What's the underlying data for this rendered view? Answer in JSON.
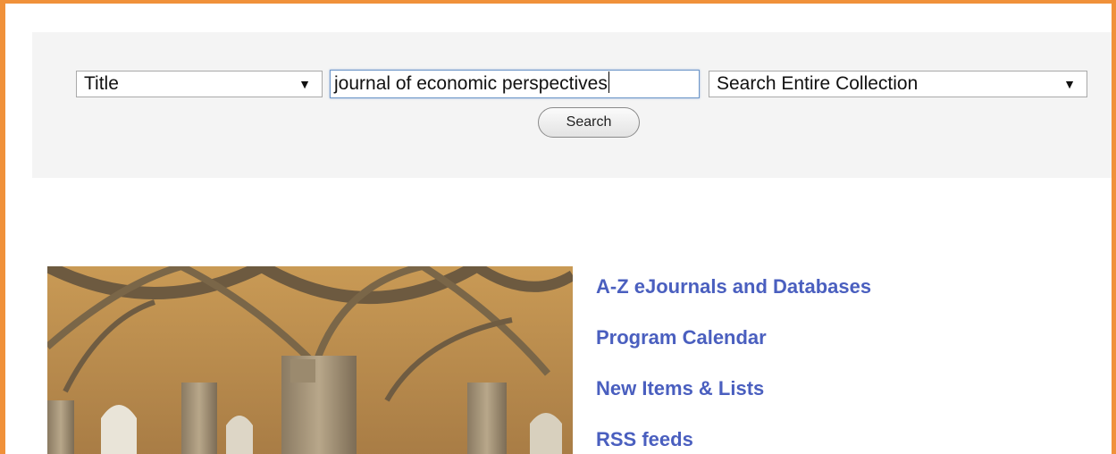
{
  "search": {
    "field_type": {
      "selected": "Title"
    },
    "query": {
      "value": "journal of economic perspectives"
    },
    "scope": {
      "selected": "Search Entire Collection"
    },
    "submit_label": "Search"
  },
  "quick_links": [
    {
      "label": "A-Z eJournals and Databases"
    },
    {
      "label": "Program Calendar"
    },
    {
      "label": "New Items & Lists"
    },
    {
      "label": "RSS feeds"
    }
  ],
  "colors": {
    "frame_border": "#f0913a",
    "search_panel_bg": "#f4f4f4",
    "link": "#4a5fbf",
    "input_focus_border": "#6e97c9"
  },
  "icons": {
    "dropdown": "triangle-down"
  }
}
